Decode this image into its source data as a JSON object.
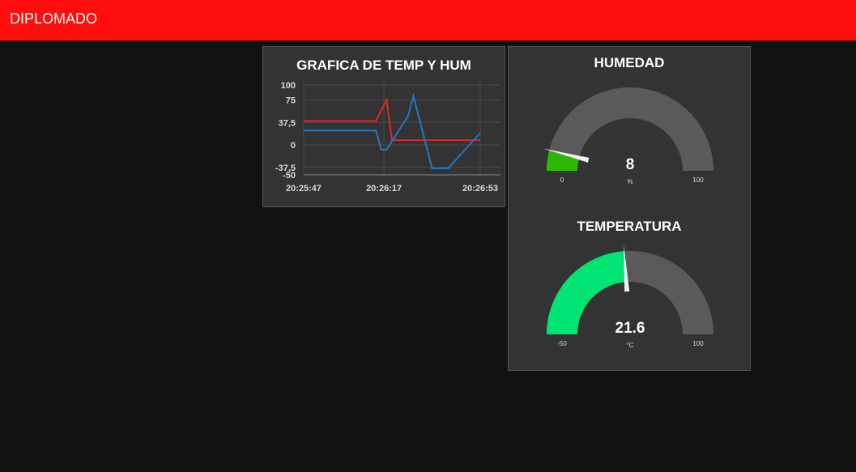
{
  "header": {
    "title": "DIPLOMADO",
    "color": "#ff0e0e"
  },
  "chart_card": {
    "title": "GRAFICA DE TEMP Y HUM"
  },
  "chart_data": {
    "type": "line",
    "title": "GRAFICA DE TEMP Y HUM",
    "xlabel": "",
    "ylabel": "",
    "ylim": [
      -50,
      100
    ],
    "y_ticks": [
      "100",
      "75",
      "37,5",
      "0",
      "-37,5",
      "-50"
    ],
    "x_ticks": [
      "20:25:47",
      "20:26:17",
      "20:26:53"
    ],
    "grid": true,
    "series": [
      {
        "color": "#e0262a",
        "x": [
          "20:25:47",
          "20:26:14",
          "20:26:18",
          "20:26:20",
          "20:26:40",
          "20:26:53"
        ],
        "values": [
          40,
          40,
          75,
          8,
          8,
          8
        ]
      },
      {
        "color": "#1f7ac4",
        "x": [
          "20:25:47",
          "20:26:14",
          "20:26:16",
          "20:26:18",
          "20:26:26",
          "20:26:28",
          "20:26:35",
          "20:26:39",
          "20:26:40",
          "20:26:41",
          "20:26:53"
        ],
        "values": [
          24,
          24,
          -8,
          -8,
          48,
          82,
          -39,
          -39,
          -39,
          -39,
          20
        ]
      }
    ]
  },
  "gauges": [
    {
      "title": "HUMEDAD",
      "value": 8,
      "display": "8",
      "unit": "%",
      "min": 0,
      "max": 100,
      "min_label": "0",
      "max_label": "100",
      "fill_color": "#2cb800",
      "track_color": "#5a5a5a"
    },
    {
      "title": "TEMPERATURA",
      "value": 21.6,
      "display": "21.6",
      "unit": "°C",
      "min": -50,
      "max": 100,
      "min_label": "-50",
      "max_label": "100",
      "fill_color": "#00e572",
      "track_color": "#5a5a5a"
    }
  ]
}
